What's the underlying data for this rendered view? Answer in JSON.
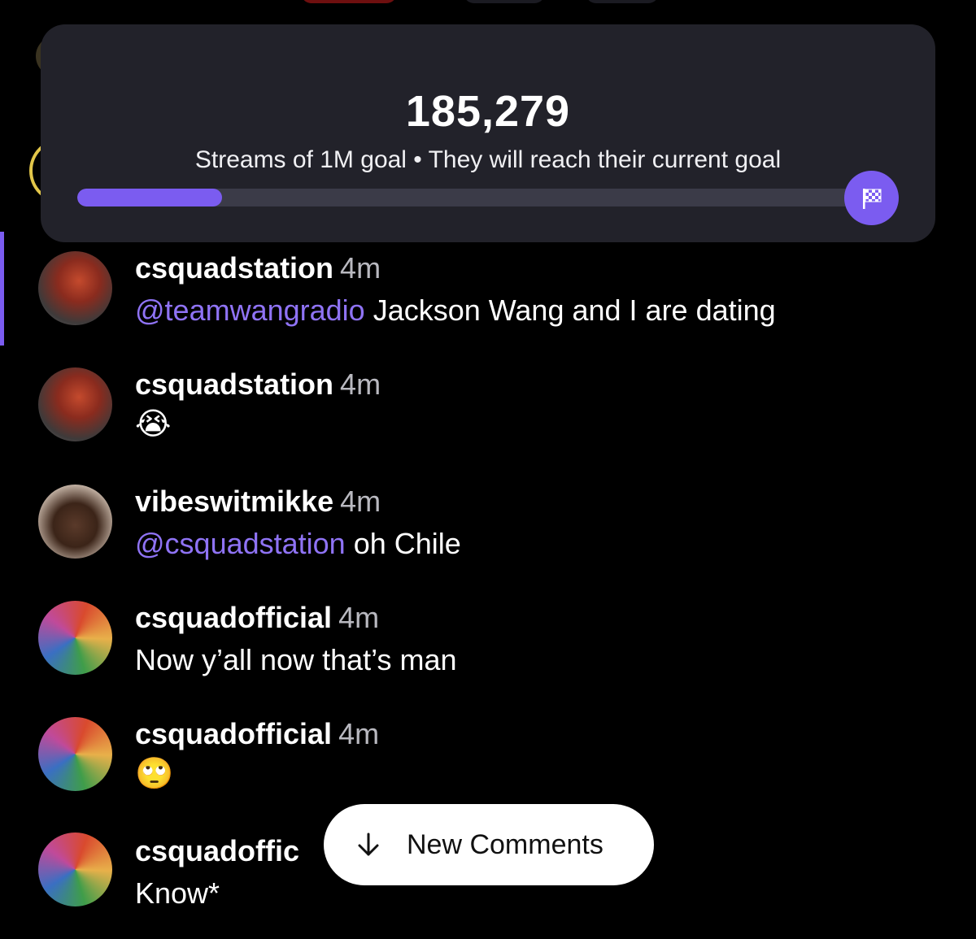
{
  "goal": {
    "count": "185,279",
    "subtitle": "Streams of 1M goal • They will reach their current goal",
    "progress_fraction": 0.185,
    "flag_icon": "checkered-flag-icon"
  },
  "comments": [
    {
      "user": "csquadstation",
      "time": "4m",
      "mention": "@teamwangradio",
      "text": " Jackson Wang and I are dating"
    },
    {
      "user": "csquadstation",
      "time": "4m",
      "mention": "",
      "text": "😭"
    },
    {
      "user": "vibeswitmikke",
      "time": "4m",
      "mention": "@csquadstation",
      "text": " oh Chile"
    },
    {
      "user": "csquadofficial",
      "time": "4m",
      "mention": "",
      "text": "Now y’all now that’s man"
    },
    {
      "user": "csquadofficial",
      "time": "4m",
      "mention": "",
      "text": "🙄"
    },
    {
      "user": "csquadoffic",
      "time": "",
      "mention": "",
      "text": "Know*"
    }
  ],
  "new_comments_button": {
    "label": "New Comments",
    "icon": "arrow-down-icon"
  },
  "colors": {
    "accent": "#7b5cf0",
    "mention": "#8f73f5",
    "card": "#22222a",
    "background": "#000000"
  }
}
